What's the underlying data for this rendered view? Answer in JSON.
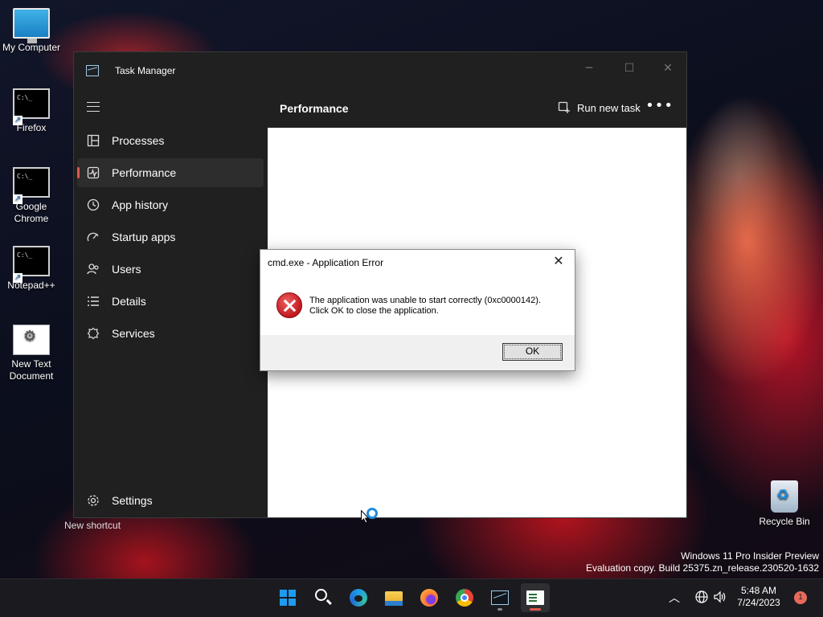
{
  "desktop": {
    "icons": [
      {
        "label": "My Computer",
        "icon": "monitor-icon"
      },
      {
        "label": "Firefox",
        "icon": "cmd-shortcut-icon"
      },
      {
        "label": "Google Chrome",
        "icon": "cmd-shortcut-icon"
      },
      {
        "label": "Notepad++",
        "icon": "cmd-shortcut-icon"
      },
      {
        "label": "New Text Document",
        "icon": "settings-document-icon"
      }
    ],
    "new_shortcut_label": "New shortcut",
    "recycle_bin_label": "Recycle Bin"
  },
  "task_manager": {
    "title": "Task Manager",
    "page_title": "Performance",
    "run_new_task_label": "Run new task",
    "more_label": "•••",
    "nav": [
      {
        "label": "Processes",
        "icon": "processes-icon",
        "active": false
      },
      {
        "label": "Performance",
        "icon": "performance-icon",
        "active": true
      },
      {
        "label": "App history",
        "icon": "history-icon",
        "active": false
      },
      {
        "label": "Startup apps",
        "icon": "startup-icon",
        "active": false
      },
      {
        "label": "Users",
        "icon": "users-icon",
        "active": false
      },
      {
        "label": "Details",
        "icon": "details-icon",
        "active": false
      },
      {
        "label": "Services",
        "icon": "services-icon",
        "active": false
      }
    ],
    "settings_label": "Settings"
  },
  "dialog": {
    "title": "cmd.exe - Application Error",
    "message_line1": "The application was unable to start correctly (0xc0000142).",
    "message_line2": "Click OK to close the application.",
    "ok_label": "OK",
    "close_glyph": "✕"
  },
  "watermark": {
    "line1": "Windows 11 Pro Insider Preview",
    "line2": "Evaluation copy. Build 25375.zn_release.230520-1632"
  },
  "taskbar": {
    "apps": [
      "start",
      "search",
      "edge",
      "file-explorer",
      "firefox",
      "chrome",
      "task-manager",
      "notepad"
    ],
    "clock_time": "5:48 AM",
    "clock_date": "7/24/2023",
    "notification_count": "1"
  },
  "colors": {
    "accent": "#e2584f",
    "taskbar": "#1b1b1f",
    "tm_background": "#202020"
  }
}
